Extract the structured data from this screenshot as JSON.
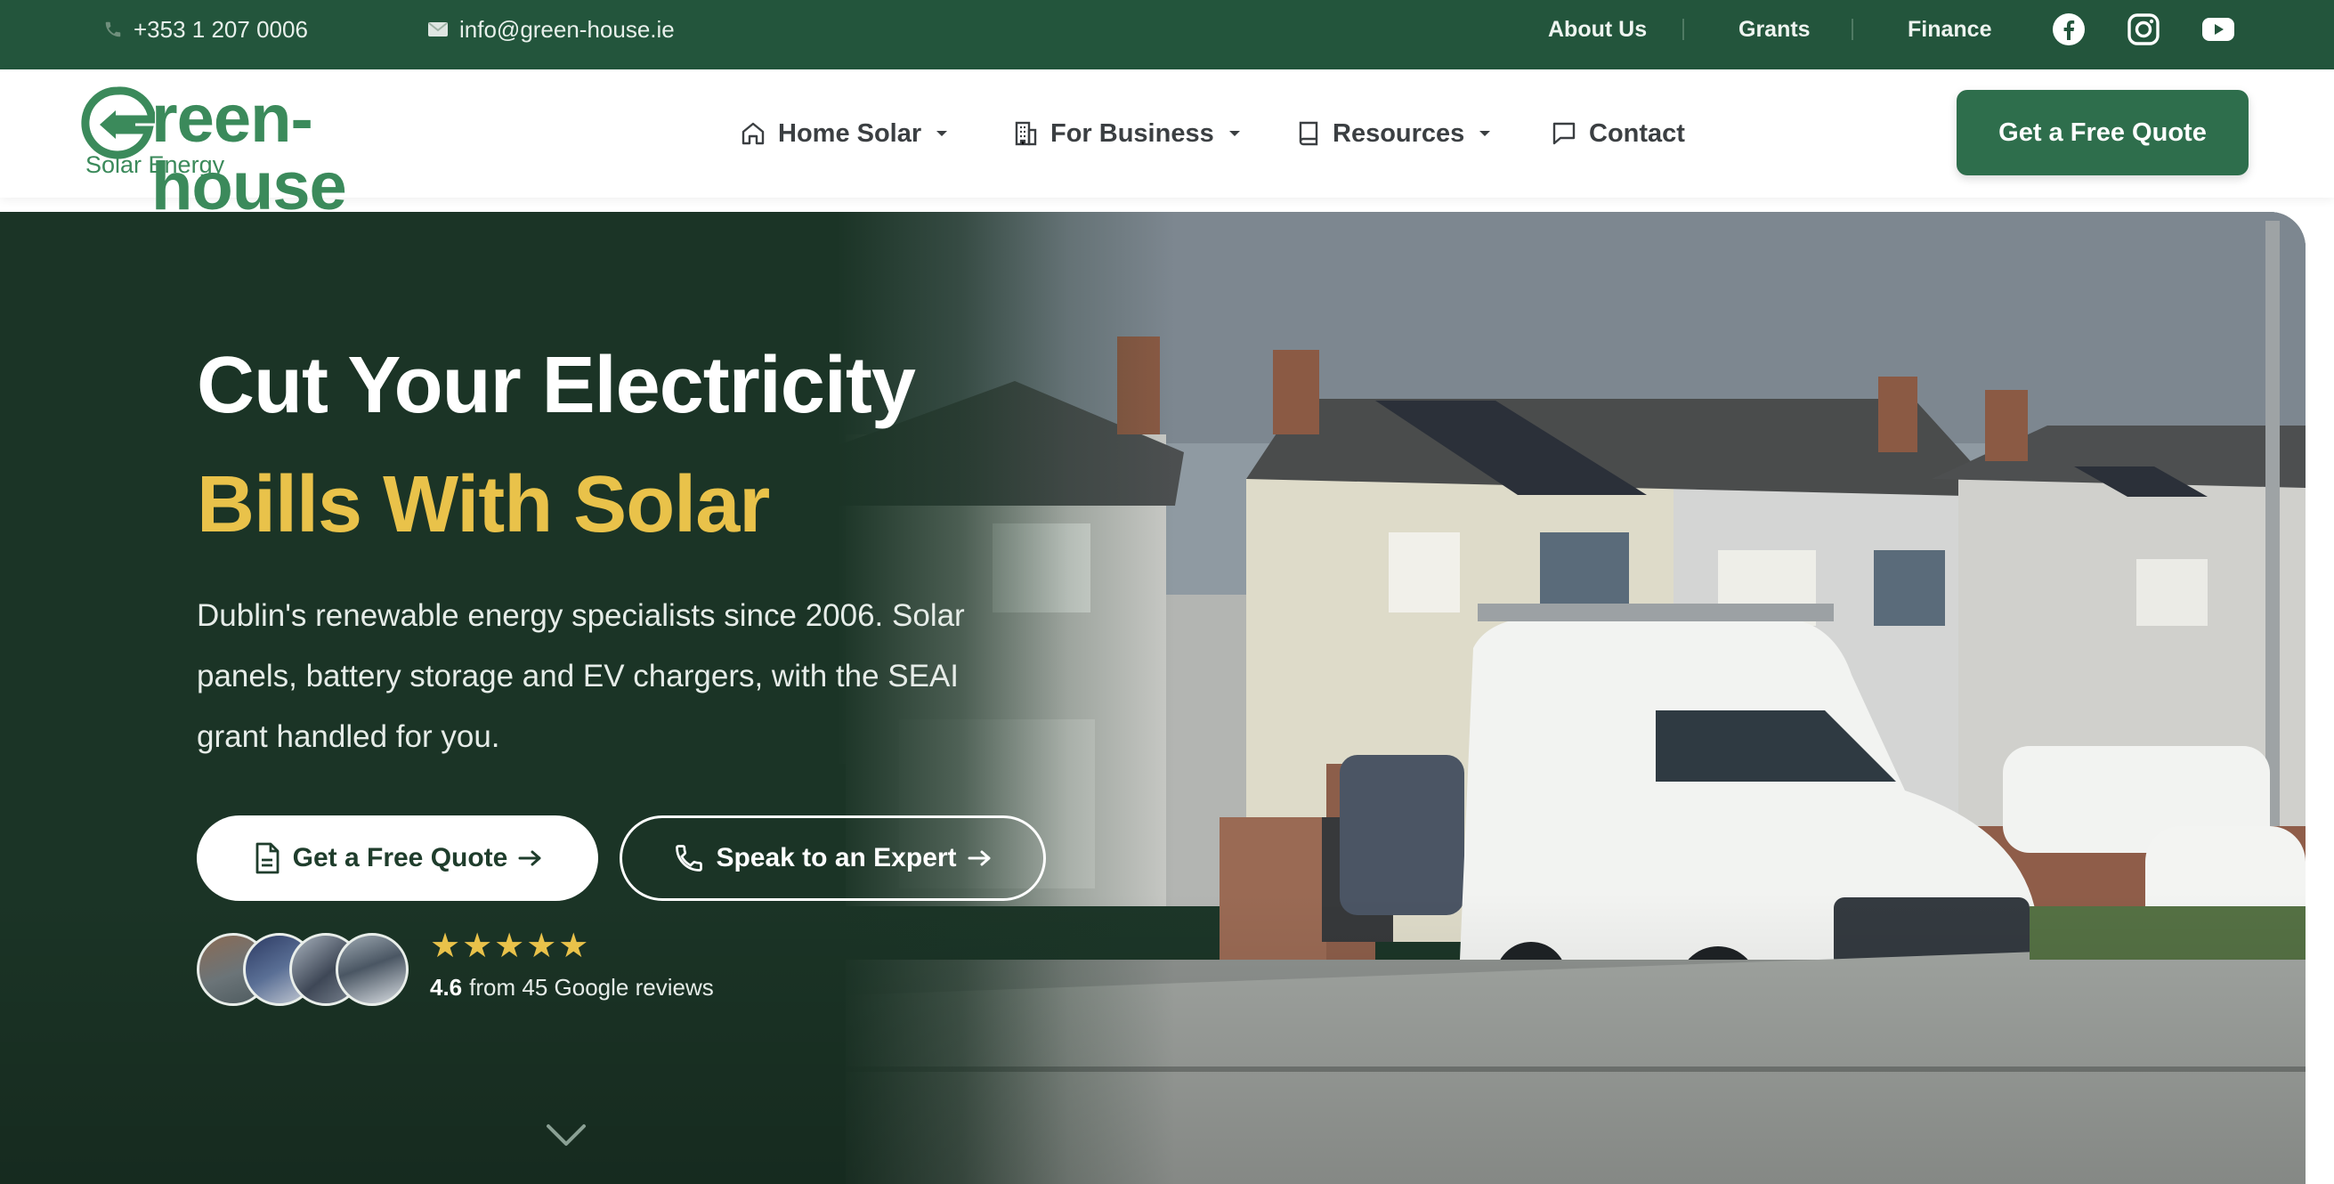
{
  "topbar": {
    "phone": "+353 1 207 0006",
    "email": "info@green-house.ie",
    "links": [
      "About Us",
      "Grants",
      "Finance"
    ],
    "social": [
      "facebook-icon",
      "instagram-icon",
      "youtube-icon"
    ]
  },
  "logo": {
    "wordmark": "reen-house",
    "subtitle": "Solar Energy"
  },
  "nav": {
    "items": [
      {
        "label": "Home Solar",
        "icon": "home-icon",
        "has_dropdown": true
      },
      {
        "label": "For Business",
        "icon": "building-icon",
        "has_dropdown": true
      },
      {
        "label": "Resources",
        "icon": "book-icon",
        "has_dropdown": true
      },
      {
        "label": "Contact",
        "icon": "chat-icon",
        "has_dropdown": false
      }
    ],
    "cta": "Get a Free Quote"
  },
  "hero": {
    "title_line1": "Cut Your Electricity",
    "title_line2": "Bills With Solar",
    "lead": "Dublin's renewable energy specialists since 2006. Solar panels, battery storage and EV chargers, with the SEAI grant handled for you.",
    "primary_button": "Get a Free Quote",
    "secondary_button": "Speak to an Expert",
    "stars": "★★★★★",
    "rating_value": "4.6",
    "rating_text": "from 45 Google reviews"
  },
  "colors": {
    "brand_green": "#23553c",
    "button_green": "#2e6e4c",
    "accent_yellow": "#e9c24a",
    "logo_green": "#3b8a5b"
  }
}
